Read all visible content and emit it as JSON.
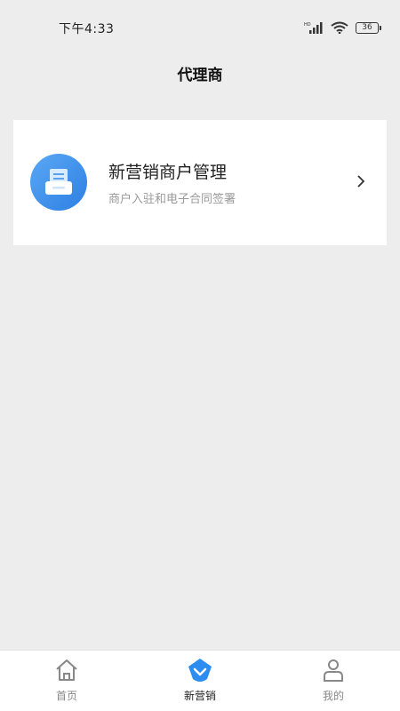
{
  "status_bar": {
    "time": "下午4:33",
    "signal_label": "HD",
    "battery_level": "36",
    "icons": [
      "signal-icon",
      "wifi-icon",
      "battery-icon"
    ]
  },
  "header": {
    "title": "代理商"
  },
  "menu": {
    "items": [
      {
        "title": "新营销商户管理",
        "subtitle": "商户入驻和电子合同签署",
        "icon": "document-tray-icon"
      }
    ]
  },
  "tabbar": {
    "active_index": 1,
    "tabs": [
      {
        "label": "首页",
        "icon": "home-icon"
      },
      {
        "label": "新营销",
        "icon": "diamond-check-icon"
      },
      {
        "label": "我的",
        "icon": "user-icon"
      }
    ]
  },
  "colors": {
    "accent": "#2d8cf0",
    "background": "#ededed"
  }
}
